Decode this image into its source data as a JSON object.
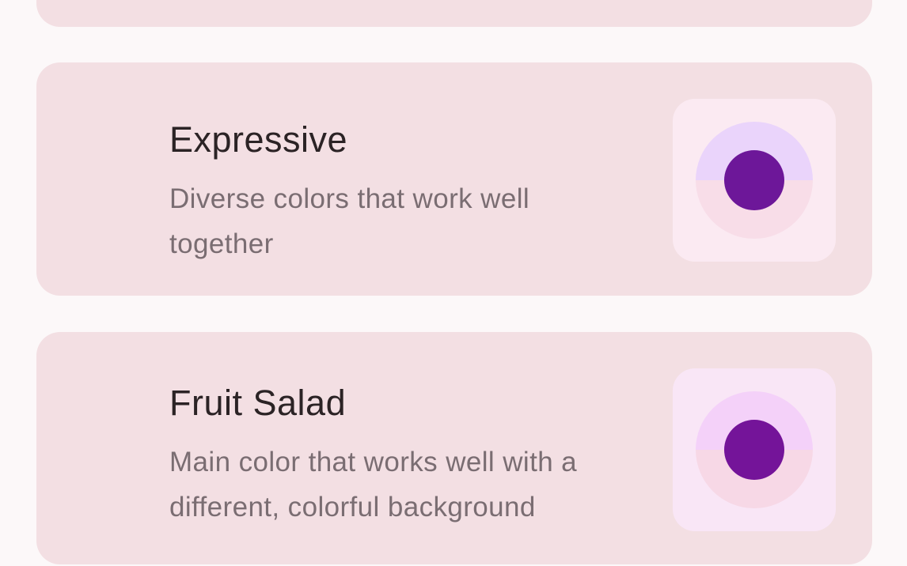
{
  "options": [
    {
      "id": "expressive",
      "title": "Expressive",
      "description": "Diverse colors that work well together",
      "swatch": {
        "top": "#ead4fb",
        "bottom": "#f8dde8",
        "center": "#6d1799"
      }
    },
    {
      "id": "fruit-salad",
      "title": "Fruit Salad",
      "description": "Main color that works well with a different, colorful background",
      "swatch": {
        "top": "#f4d1f9",
        "bottom": "#f7d8e6",
        "center": "#741499"
      }
    }
  ]
}
